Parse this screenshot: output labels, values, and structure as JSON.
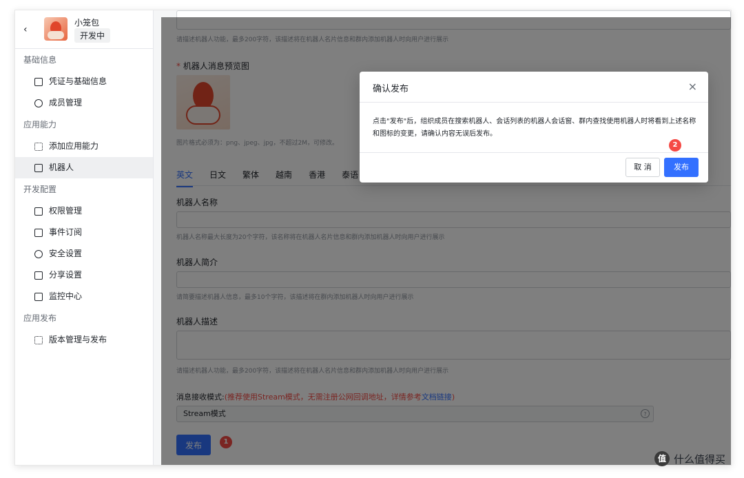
{
  "app": {
    "name": "小笼包",
    "status": "开发中",
    "back_icon": "chevron-left-icon"
  },
  "sidebar": {
    "groups": [
      {
        "title": "基础信息",
        "items": [
          {
            "label": "凭证与基础信息",
            "icon": "credential-icon"
          },
          {
            "label": "成员管理",
            "icon": "user-icon"
          }
        ]
      },
      {
        "title": "应用能力",
        "items": [
          {
            "label": "添加应用能力",
            "icon": "grid-icon"
          },
          {
            "label": "机器人",
            "icon": "robot-icon",
            "active": true
          }
        ]
      },
      {
        "title": "开发配置",
        "items": [
          {
            "label": "权限管理",
            "icon": "lock-icon"
          },
          {
            "label": "事件订阅",
            "icon": "event-icon"
          },
          {
            "label": "安全设置",
            "icon": "shield-icon"
          },
          {
            "label": "分享设置",
            "icon": "share-icon"
          },
          {
            "label": "监控中心",
            "icon": "monitor-icon"
          }
        ]
      },
      {
        "title": "应用发布",
        "items": [
          {
            "label": "版本管理与发布",
            "icon": "layers-icon"
          }
        ]
      }
    ]
  },
  "main": {
    "top_hint": "请描述机器人功能，最多200字符，该描述将在机器人名片信息和群内添加机器人时向用户进行展示",
    "preview_label": "机器人消息预览图",
    "preview_required": "*",
    "preview_hint": "图片格式必须为：png、jpeg、jpg，不超过2M，可修改。",
    "tabs": [
      "英文",
      "日文",
      "繁体",
      "越南",
      "香港",
      "泰语"
    ],
    "name_label": "机器人名称",
    "name_hint": "机器人名称最大长度为20个字符，该名称将在机器人名片信息和群内添加机器人时向用户进行展示",
    "intro_label": "机器人简介",
    "intro_hint": "请简要描述机器人信息，最多10个字符，该描述将在群内添加机器人时向用户进行展示",
    "desc_label": "机器人描述",
    "desc_hint": "请描述机器人功能，最多200字符，该描述将在机器人名片信息和群内添加机器人时向用户进行展示",
    "mode_label": "消息接收模式:",
    "mode_note_red": "(推荐使用Stream模式，无需注册公网回调地址，详情参考",
    "mode_note_link": "文档链接",
    "mode_note_end": ")",
    "mode_value": "Stream模式",
    "help_icon": "?",
    "publish_label": "发布",
    "marker1": "1"
  },
  "dialog": {
    "title": "确认发布",
    "close": "×",
    "body": "点击\"发布\"后，组织成员在搜索机器人、会话列表的机器人会话窗、群内查找使用机器人时将看到上述名称和图标的变更，请确认内容无误后发布。",
    "cancel_label": "取 消",
    "confirm_label": "发布",
    "marker2": "2"
  },
  "watermark": {
    "icon_text": "值",
    "text": "什么值得买"
  }
}
